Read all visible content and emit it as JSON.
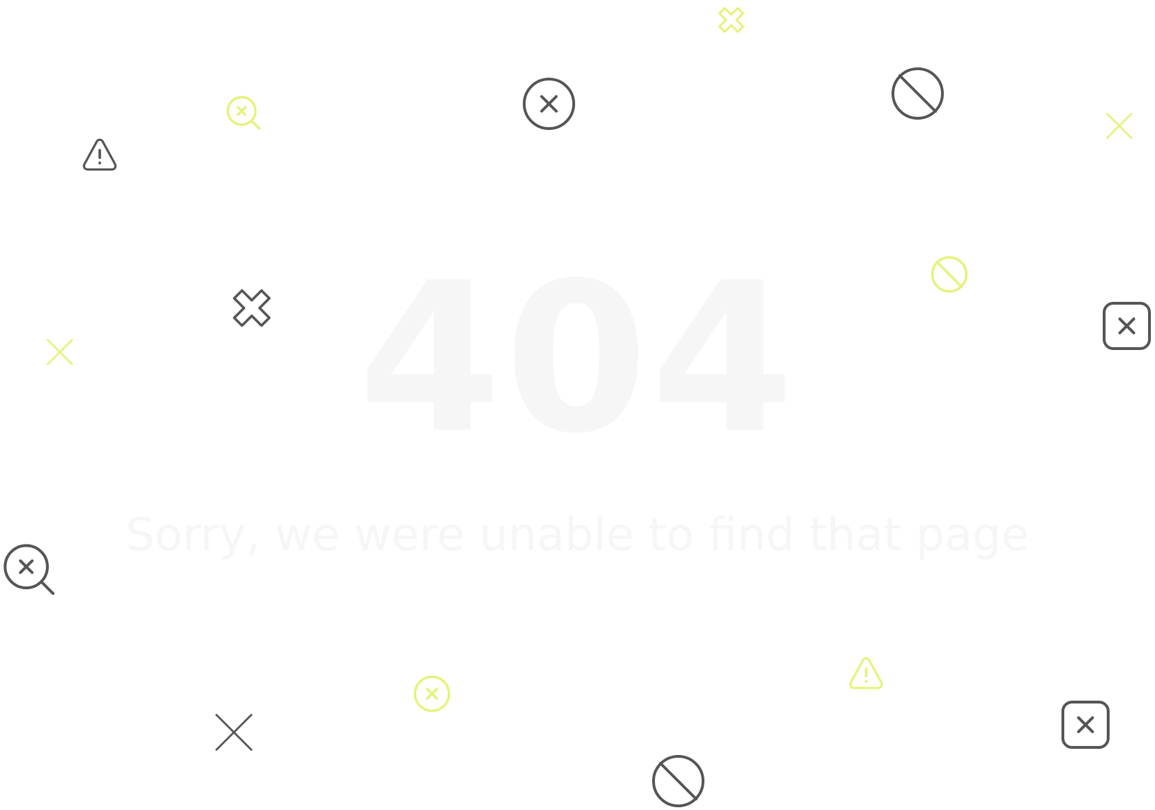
{
  "page": {
    "error_code": "404",
    "message": "Sorry, we were unable to find that page"
  },
  "colors": {
    "background": "#ffffff",
    "text_faded": "#f6f6f6",
    "icon_dark": "#555555",
    "icon_accent": "#e6f27a"
  },
  "icons": [
    {
      "name": "close-icon",
      "color": "accent"
    },
    {
      "name": "search-x-icon",
      "color": "accent"
    },
    {
      "name": "x-circle-icon",
      "color": "dark"
    },
    {
      "name": "prohibited-icon",
      "color": "dark"
    },
    {
      "name": "x-icon",
      "color": "accent"
    },
    {
      "name": "warning-icon",
      "color": "dark"
    },
    {
      "name": "close-icon",
      "color": "dark"
    },
    {
      "name": "x-icon",
      "color": "accent"
    },
    {
      "name": "prohibited-icon",
      "color": "accent"
    },
    {
      "name": "x-square-icon",
      "color": "dark"
    },
    {
      "name": "search-x-icon",
      "color": "dark"
    },
    {
      "name": "warning-icon",
      "color": "accent"
    },
    {
      "name": "x-circle-icon",
      "color": "accent"
    },
    {
      "name": "x-icon",
      "color": "dark"
    },
    {
      "name": "x-square-icon",
      "color": "dark"
    },
    {
      "name": "prohibited-icon",
      "color": "dark"
    }
  ]
}
